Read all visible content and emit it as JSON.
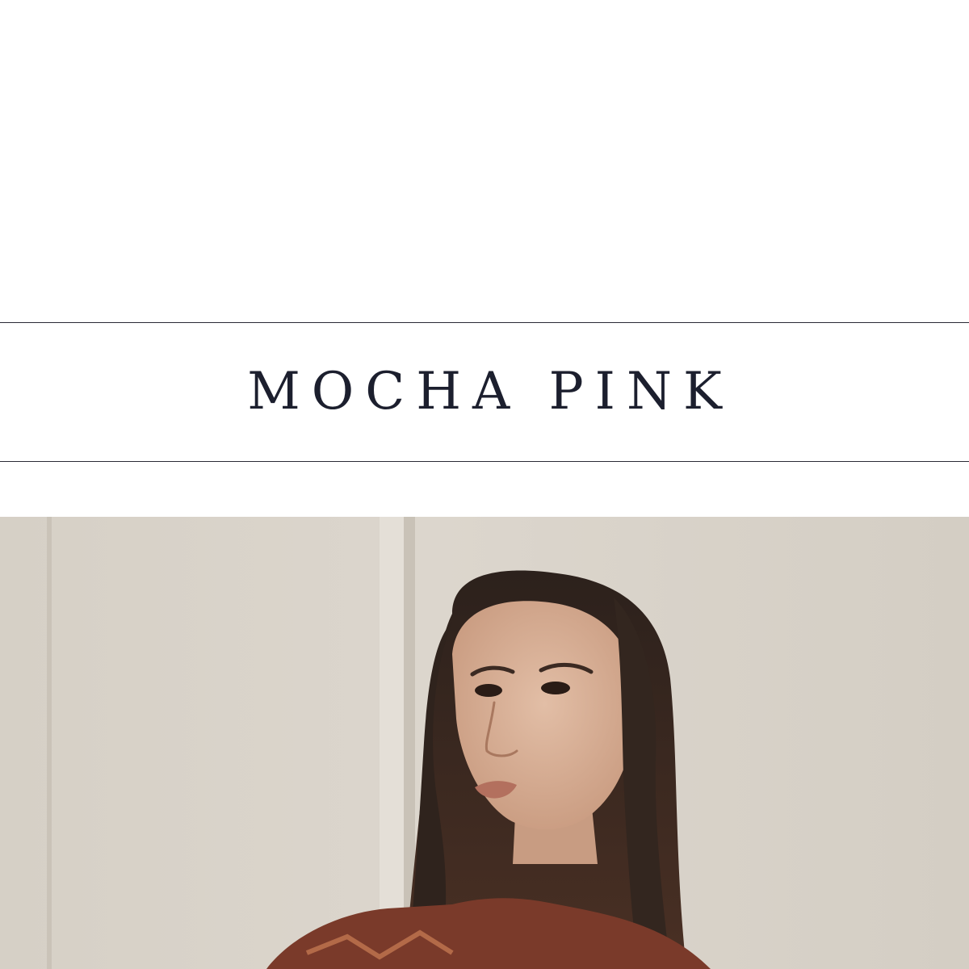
{
  "banner": {
    "title": "MOCHA PINK"
  },
  "photo": {
    "subject": "model-portrait",
    "colors": {
      "wall": "#d9d3ca",
      "hair": "#3a2a22",
      "skin": "#d8b29a",
      "sweater": "#7a3a2a"
    }
  }
}
